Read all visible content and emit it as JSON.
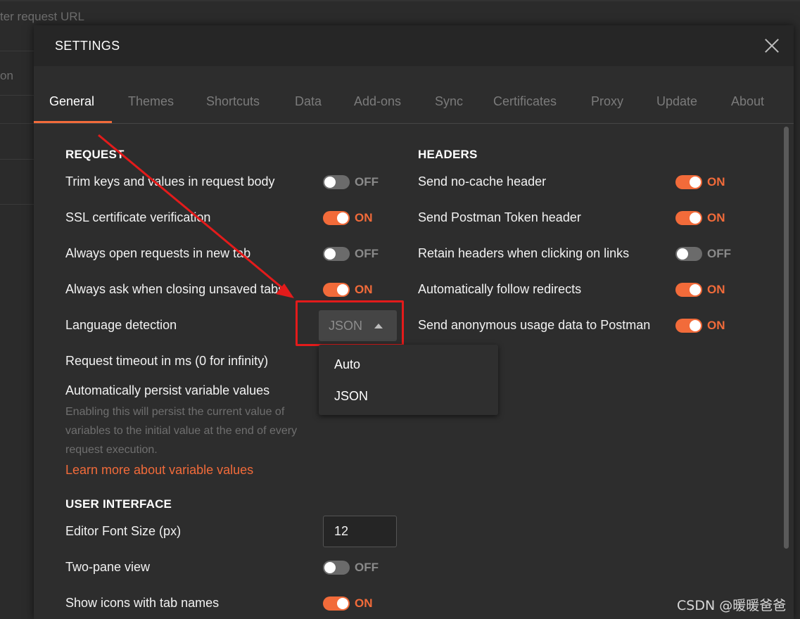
{
  "background": {
    "url_placeholder": "ter request URL",
    "side_text": "on"
  },
  "modal": {
    "title": "SETTINGS",
    "close_icon": "close-icon"
  },
  "tabs": [
    "General",
    "Themes",
    "Shortcuts",
    "Data",
    "Add-ons",
    "Sync",
    "Certificates",
    "Proxy",
    "Update",
    "About"
  ],
  "active_tab": "General",
  "request": {
    "heading": "REQUEST",
    "settings": [
      {
        "label": "Trim keys and values in request body",
        "state": "OFF"
      },
      {
        "label": "SSL certificate verification",
        "state": "ON"
      },
      {
        "label": "Always open requests in new tab",
        "state": "OFF"
      },
      {
        "label": "Always ask when closing unsaved tabs",
        "state": "ON"
      }
    ],
    "language_detection": {
      "label": "Language detection",
      "value": "JSON",
      "options": [
        "Auto",
        "JSON"
      ]
    },
    "timeout_label": "Request timeout in ms (0 for infinity)",
    "persist_label": "Automatically persist variable values",
    "persist_desc": "Enabling this will persist the current value of variables to the initial value at the end of every request execution.",
    "learn_more": "Learn more about variable values"
  },
  "headers": {
    "heading": "HEADERS",
    "settings": [
      {
        "label": "Send no-cache header",
        "state": "ON"
      },
      {
        "label": "Send Postman Token header",
        "state": "ON"
      },
      {
        "label": "Retain headers when clicking on links",
        "state": "OFF"
      },
      {
        "label": "Automatically follow redirects",
        "state": "ON"
      },
      {
        "label": "Send anonymous usage data to Postman",
        "state": "ON"
      }
    ]
  },
  "ui": {
    "heading": "USER INTERFACE",
    "font_size_label": "Editor Font Size (px)",
    "font_size_value": "12",
    "two_pane": {
      "label": "Two-pane view",
      "state": "OFF"
    },
    "show_icons": {
      "label": "Show icons with tab names",
      "state": "ON"
    }
  },
  "watermark": "CSDN @暖暖爸爸",
  "colors": {
    "accent": "#f26b3a",
    "annotation": "#e31b1b"
  }
}
